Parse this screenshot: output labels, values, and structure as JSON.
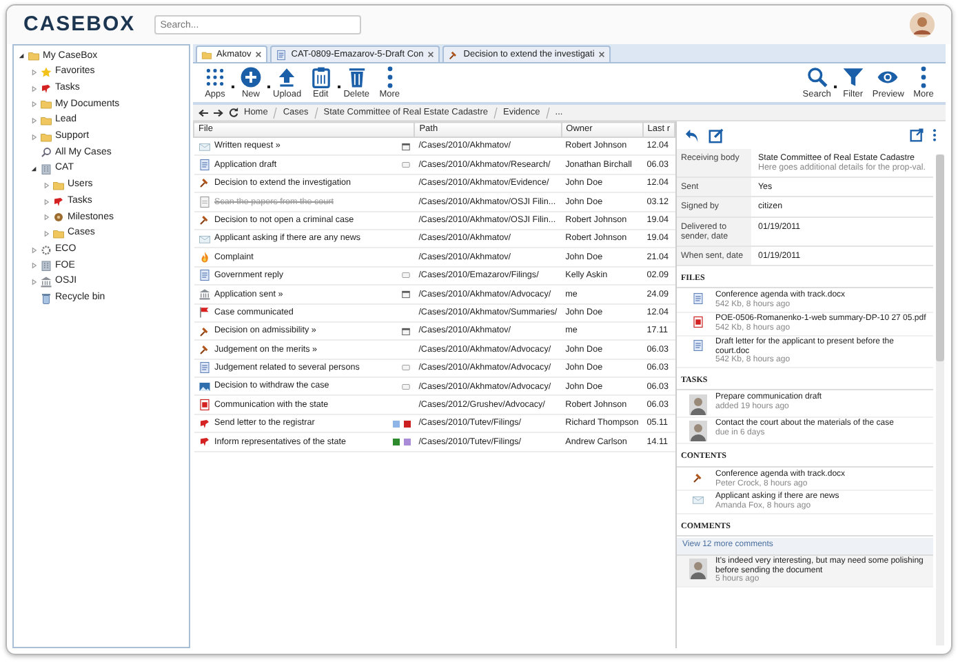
{
  "header": {
    "logo": "CASEBOX",
    "search": {
      "placeholder": "Search..."
    }
  },
  "tree": [
    {
      "label": "My CaseBox",
      "kind": "folder",
      "expanded": true,
      "children": [
        {
          "label": "Favorites",
          "kind": "star",
          "expanded": false
        },
        {
          "label": "Tasks",
          "kind": "task",
          "expanded": false
        },
        {
          "label": "My Documents",
          "kind": "folder",
          "expanded": false
        },
        {
          "label": "Lead",
          "kind": "folder",
          "expanded": false
        },
        {
          "label": "Support",
          "kind": "folder",
          "expanded": false
        },
        {
          "label": "All My Cases",
          "kind": "search"
        },
        {
          "label": "CAT",
          "kind": "building",
          "expanded": true,
          "children": [
            {
              "label": "Users",
              "kind": "folder",
              "expanded": false
            },
            {
              "label": "Tasks",
              "kind": "task",
              "expanded": false
            },
            {
              "label": "Milestones",
              "kind": "milestone",
              "expanded": false
            },
            {
              "label": "Cases",
              "kind": "folder",
              "expanded": false
            }
          ]
        },
        {
          "label": "ECO",
          "kind": "gear",
          "expanded": false
        },
        {
          "label": "FOE",
          "kind": "building",
          "expanded": false
        },
        {
          "label": "OSJI",
          "kind": "bank",
          "expanded": false
        },
        {
          "label": "Recycle bin",
          "kind": "bin"
        }
      ]
    }
  ],
  "tabs": [
    {
      "label": "Akmatov",
      "kind": "folder",
      "selected": true
    },
    {
      "label": "CAT-0809-Emazarov-5-Draft Con",
      "kind": "doc",
      "selected": false
    },
    {
      "label": "Decision to extend the investigati",
      "kind": "gavel",
      "selected": false
    }
  ],
  "toolbar": {
    "left": [
      {
        "label": "Apps",
        "kind": "apps",
        "dropdown": true
      },
      {
        "label": "New",
        "kind": "new",
        "dropdown": true
      },
      {
        "label": "Upload",
        "kind": "upload",
        "dropdown": false
      },
      {
        "label": "Edit",
        "kind": "edit",
        "dropdown": true
      },
      {
        "label": "Delete",
        "kind": "delete",
        "dropdown": false
      },
      {
        "label": "More",
        "kind": "more",
        "dropdown": false
      }
    ],
    "right": [
      {
        "label": "Search",
        "kind": "search",
        "dropdown": true
      },
      {
        "label": "Filter",
        "kind": "filter",
        "dropdown": false
      },
      {
        "label": "Preview",
        "kind": "preview",
        "dropdown": false
      },
      {
        "label": "More",
        "kind": "more",
        "dropdown": false
      }
    ]
  },
  "breadcrumb": [
    "Home",
    "Cases",
    "State Committee of Real Estate Cadastre",
    "Evidence",
    "..."
  ],
  "table": {
    "columns": [
      "File",
      "Path",
      "Owner",
      "Last r"
    ],
    "rows": [
      {
        "file": "Written request »",
        "kind": "mail",
        "indicator": {
          "kind": "calendar"
        },
        "path": "/Cases/2010/Akhmatov/",
        "owner": "Robert Johnson",
        "date": "12.04"
      },
      {
        "file": "Application draft",
        "kind": "doc",
        "indicator": {
          "kind": "comment"
        },
        "path": "/Cases/2010/Akhmatov/Research/",
        "owner": "Jonathan Birchall",
        "date": "06.03"
      },
      {
        "file": "Decision to extend the investigation",
        "kind": "gavel",
        "path": "/Cases/2010/Akhmatov/Evidence/",
        "owner": "John Doe",
        "date": "12.04"
      },
      {
        "file": "Scan the papers from the court",
        "kind": "scan",
        "struck": true,
        "path": "/Cases/2010/Akhmatov/OSJI Filin...",
        "owner": "John Doe",
        "date": "03.12"
      },
      {
        "file": "Decision to not open a criminal case",
        "kind": "gavel",
        "path": "/Cases/2010/Akhmatov/OSJI Filin...",
        "owner": "Robert Johnson",
        "date": "19.04"
      },
      {
        "file": "Applicant asking if there are any news",
        "kind": "mail",
        "path": "/Cases/2010/Akhmatov/",
        "owner": "Robert Johnson",
        "date": "19.04"
      },
      {
        "file": "Complaint",
        "kind": "fire",
        "path": "/Cases/2010/Akhmatov/",
        "owner": "John Doe",
        "date": "21.04"
      },
      {
        "file": "Government reply",
        "kind": "doc",
        "indicator": {
          "kind": "comment"
        },
        "path": "/Cases/2010/Emazarov/Filings/",
        "owner": "Kelly Askin",
        "date": "02.09"
      },
      {
        "file": "Application sent »",
        "kind": "bank",
        "indicator": {
          "kind": "calendar"
        },
        "path": "/Cases/2010/Akhmatov/Advocacy/",
        "owner": "me",
        "date": "24.09"
      },
      {
        "file": "Case communicated",
        "kind": "flag",
        "path": "/Cases/2010/Akhmatov/Summaries/",
        "owner": "John Doe",
        "date": "12.04"
      },
      {
        "file": "Decision on admissibility »",
        "kind": "gavel",
        "indicator": {
          "kind": "calendar"
        },
        "path": "/Cases/2010/Akhmatov/",
        "owner": "me",
        "date": "17.11"
      },
      {
        "file": "Judgement on the merits »",
        "kind": "gavel",
        "path": "/Cases/2010/Akhmatov/Advocacy/",
        "owner": "John Doe",
        "date": "06.03"
      },
      {
        "file": "Judgement related to several persons",
        "kind": "doc",
        "indicator": {
          "kind": "comment"
        },
        "path": "/Cases/2010/Akhmatov/Advocacy/",
        "owner": "John Doe",
        "date": "06.03"
      },
      {
        "file": "Decision to withdraw the case",
        "kind": "image",
        "indicator": {
          "kind": "comment"
        },
        "path": "/Cases/2010/Akhmatov/Advocacy/",
        "owner": "John Doe",
        "date": "06.03"
      },
      {
        "file": "Communication with the state",
        "kind": "pdf",
        "path": "/Cases/2012/Grushev/Advocacy/",
        "owner": "Robert Johnson",
        "date": "06.03"
      },
      {
        "file": "Send letter to the registrar",
        "kind": "task",
        "tags": [
          {
            "color": "#8fb4e8"
          },
          {
            "color": "#cc1f1f"
          }
        ],
        "path": "/Cases/2010/Tutev/Filings/",
        "owner": "Richard Thompson",
        "date": "05.11"
      },
      {
        "file": "Inform representatives of the state",
        "kind": "task",
        "tags": [
          {
            "color": "#2d8a2d"
          },
          {
            "color": "#a98bd8"
          }
        ],
        "path": "/Cases/2010/Tutev/Filings/",
        "owner": "Andrew Carlson",
        "date": "14.11"
      }
    ]
  },
  "preview": {
    "properties": [
      {
        "label": "Receiving body",
        "value": "State Committee of Real Estate Cadastre",
        "note": "Here goes additional details for the prop-val."
      },
      {
        "label": "Sent",
        "value": "Yes"
      },
      {
        "label": "Signed by",
        "value": "citizen"
      },
      {
        "label": "Delivered to sender, date",
        "value": "01/19/2011"
      },
      {
        "label": "When sent, date",
        "value": "01/19/2011"
      }
    ],
    "files_heading": "FILES",
    "files": [
      {
        "name": "Conference agenda with track.docx",
        "meta": "542 Kb, 8 hours ago",
        "kind": "doc"
      },
      {
        "name": "POE-0506-Romanenko-1-web summary-DP-10 27 05.pdf",
        "meta": "542 Kb, 8 hours ago",
        "kind": "pdf"
      },
      {
        "name": "Draft letter for the applicant to present before the court.doc",
        "meta": "542 Kb, 8 hours ago",
        "kind": "doc"
      }
    ],
    "tasks_heading": "TASKS",
    "tasks": [
      {
        "title": "Prepare communication draft",
        "meta": "added 19 hours ago"
      },
      {
        "title": "Contact the court about the materials of the case",
        "meta": "due in 6 days"
      }
    ],
    "contents_heading": "CONTENTS",
    "contents": [
      {
        "title": "Conference agenda with track.docx",
        "meta": "Peter Crock, 8 hours ago",
        "kind": "gavel"
      },
      {
        "title": "Applicant asking if there are news",
        "meta": "Amanda Fox, 8 hours ago",
        "kind": "mail"
      }
    ],
    "comments_heading": "COMMENTS",
    "more_comments": "View 12 more comments",
    "comments": [
      {
        "text": "It's indeed very interesting, but may need some polishing before sending the document",
        "meta": "5 hours ago"
      }
    ]
  }
}
